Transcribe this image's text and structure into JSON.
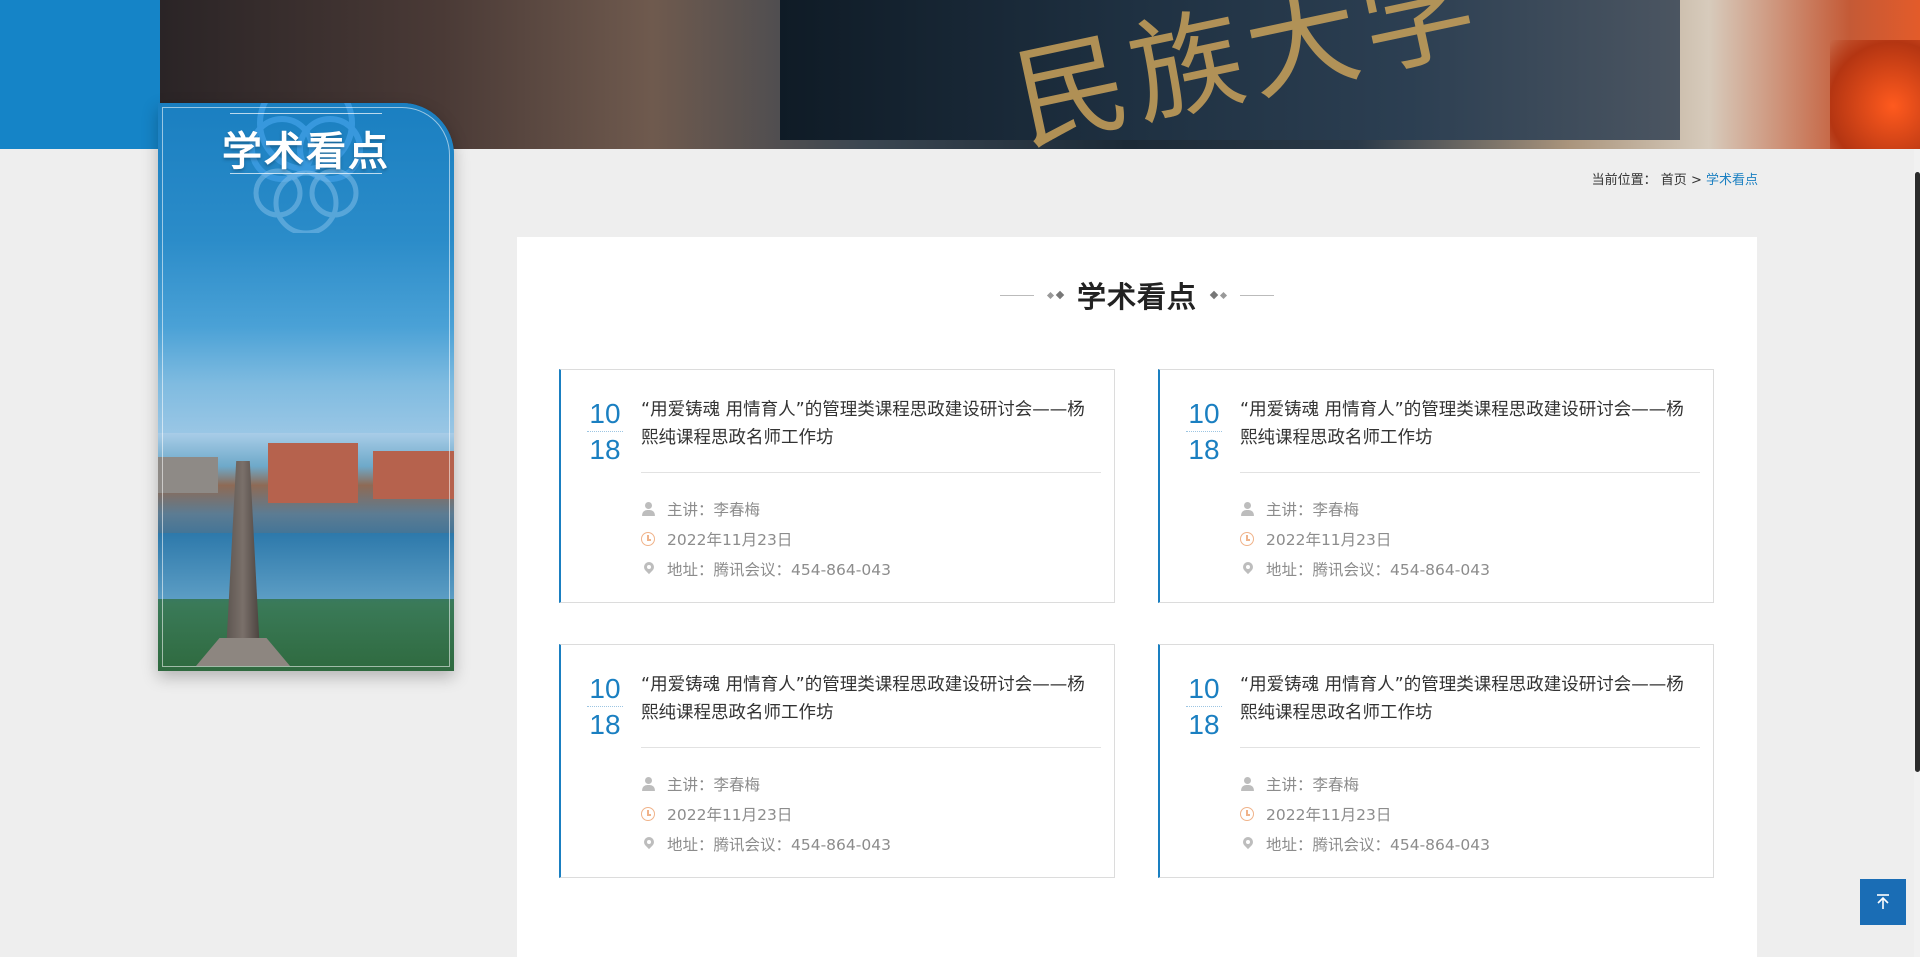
{
  "hero": {
    "banner_text": "民族大学"
  },
  "sidebar": {
    "title": "学术看点"
  },
  "breadcrumb": {
    "prefix": "当前位置：",
    "home": "首页",
    "separator": ">",
    "current": "学术看点"
  },
  "section": {
    "heading": "学术看点"
  },
  "lectures": [
    {
      "month": "10",
      "day": "18",
      "title": "“用爱铸魂 用情育人”的管理类课程思政建设研讨会——杨熙纯课程思政名师工作坊",
      "speaker": "主讲：李春梅",
      "date": "2022年11月23日",
      "address": "地址：腾讯会议：454-864-043"
    },
    {
      "month": "10",
      "day": "18",
      "title": "“用爱铸魂 用情育人”的管理类课程思政建设研讨会——杨熙纯课程思政名师工作坊",
      "speaker": "主讲：李春梅",
      "date": "2022年11月23日",
      "address": "地址：腾讯会议：454-864-043"
    },
    {
      "month": "10",
      "day": "18",
      "title": "“用爱铸魂 用情育人”的管理类课程思政建设研讨会——杨熙纯课程思政名师工作坊",
      "speaker": "主讲：李春梅",
      "date": "2022年11月23日",
      "address": "地址：腾讯会议：454-864-043"
    },
    {
      "month": "10",
      "day": "18",
      "title": "“用爱铸魂 用情育人”的管理类课程思政建设研讨会——杨熙纯课程思政名师工作坊",
      "speaker": "主讲：李春梅",
      "date": "2022年11月23日",
      "address": "地址：腾讯会议：454-864-043"
    }
  ],
  "icons": {
    "speaker": "person-icon",
    "date": "clock-icon",
    "address": "location-pin-icon",
    "back_to_top": "arrow-up-to-top-icon"
  },
  "colors": {
    "accent": "#1a7fc1",
    "back_top": "#1a6db5",
    "clock_icon": "#f0b38a",
    "meta_text": "#8c8c8c"
  }
}
